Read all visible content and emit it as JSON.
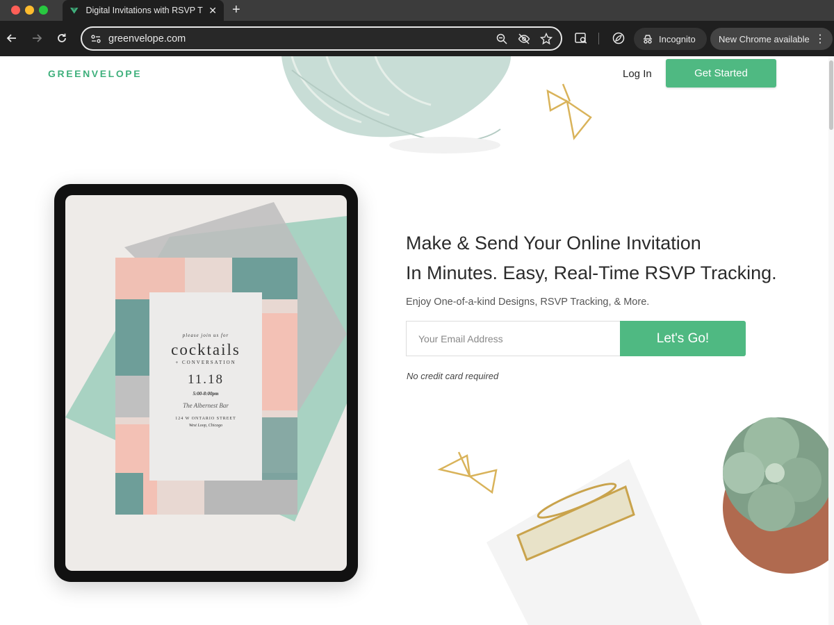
{
  "browser": {
    "tab_title": "Digital Invitations with RSVP T",
    "tab_close": "✕",
    "new_tab": "+",
    "url": "greenvelope.com",
    "incognito_label": "Incognito",
    "update_label": "New Chrome available",
    "menu_glyph": "⋮"
  },
  "header": {
    "logo": "GREENVELOPE",
    "login": "Log In",
    "get_started": "Get Started"
  },
  "hero": {
    "headline_line1": "Make & Send Your Online Invitation",
    "headline_line2": "In Minutes. Easy, Real-Time RSVP Tracking.",
    "subline": "Enjoy One-of-a-kind Designs, RSVP Tracking, & More.",
    "email_placeholder": "Your Email Address",
    "cta": "Let's Go!",
    "note": "No credit card required"
  },
  "invite": {
    "intro": "please join us for",
    "title": "cocktails",
    "subtitle": "+ CONVERSATION",
    "date": "11.18",
    "time": "5:00-8:00pm",
    "venue": "The Albernest Bar",
    "address": "124 W ONTARIO STREET",
    "city": "West Loop, Chicago"
  },
  "colors": {
    "brand_green": "#4fb982",
    "logo_green": "#3fb07c",
    "mint": "#a8d2c2",
    "teal": "#6e9e99",
    "peach": "#f3c1b5"
  }
}
